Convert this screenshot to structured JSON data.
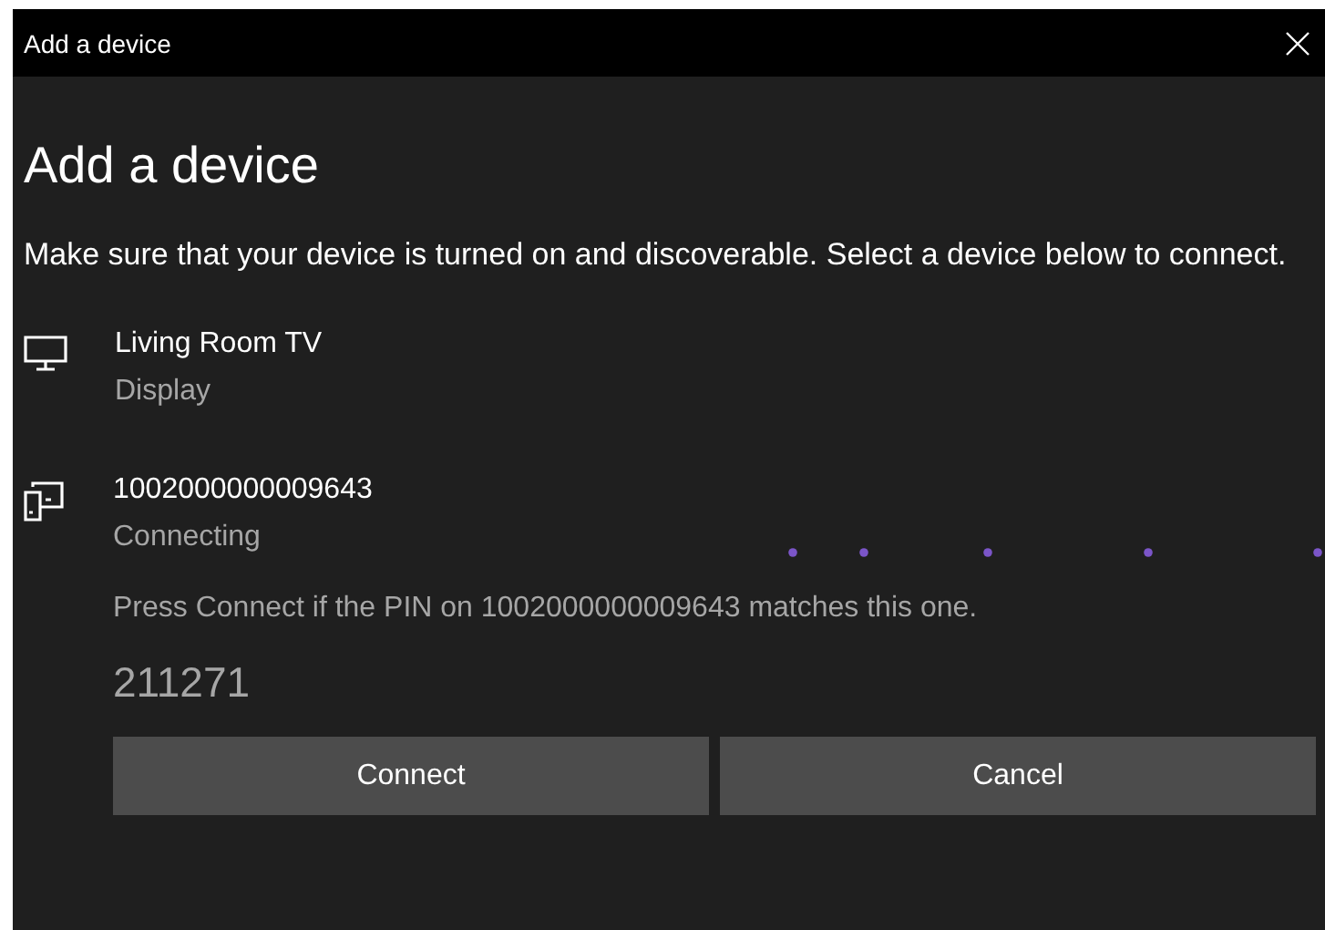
{
  "window": {
    "title": "Add a device"
  },
  "heading": "Add a device",
  "instructions": "Make sure that your device is turned on and discoverable. Select a device below to connect.",
  "devices": [
    {
      "kind": "display",
      "name": "Living Room TV",
      "status": "Display"
    },
    {
      "kind": "mobile",
      "name": "1002000000009643",
      "status": "Connecting",
      "prompt": "Press Connect if the PIN on 1002000000009643 matches this one.",
      "pin": "211271",
      "buttons": [
        "Connect",
        "Cancel"
      ]
    }
  ]
}
